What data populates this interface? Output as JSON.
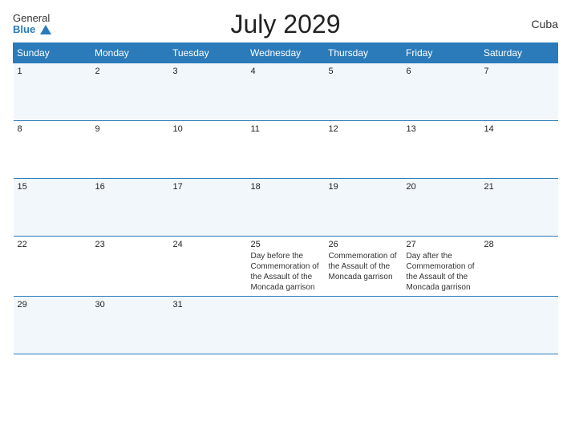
{
  "header": {
    "title": "July 2029",
    "country": "Cuba",
    "logo_general": "General",
    "logo_blue": "Blue"
  },
  "days_of_week": [
    "Sunday",
    "Monday",
    "Tuesday",
    "Wednesday",
    "Thursday",
    "Friday",
    "Saturday"
  ],
  "weeks": [
    [
      {
        "date": "1",
        "events": []
      },
      {
        "date": "2",
        "events": []
      },
      {
        "date": "3",
        "events": []
      },
      {
        "date": "4",
        "events": []
      },
      {
        "date": "5",
        "events": []
      },
      {
        "date": "6",
        "events": []
      },
      {
        "date": "7",
        "events": []
      }
    ],
    [
      {
        "date": "8",
        "events": []
      },
      {
        "date": "9",
        "events": []
      },
      {
        "date": "10",
        "events": []
      },
      {
        "date": "11",
        "events": []
      },
      {
        "date": "12",
        "events": []
      },
      {
        "date": "13",
        "events": []
      },
      {
        "date": "14",
        "events": []
      }
    ],
    [
      {
        "date": "15",
        "events": []
      },
      {
        "date": "16",
        "events": []
      },
      {
        "date": "17",
        "events": []
      },
      {
        "date": "18",
        "events": []
      },
      {
        "date": "19",
        "events": []
      },
      {
        "date": "20",
        "events": []
      },
      {
        "date": "21",
        "events": []
      }
    ],
    [
      {
        "date": "22",
        "events": []
      },
      {
        "date": "23",
        "events": []
      },
      {
        "date": "24",
        "events": []
      },
      {
        "date": "25",
        "events": [
          "Day before the Commemoration of the Assault of the Moncada garrison"
        ]
      },
      {
        "date": "26",
        "events": [
          "Commemoration of the Assault of the Moncada garrison"
        ]
      },
      {
        "date": "27",
        "events": [
          "Day after the Commemoration of the Assault of the Moncada garrison"
        ]
      },
      {
        "date": "28",
        "events": []
      }
    ],
    [
      {
        "date": "29",
        "events": []
      },
      {
        "date": "30",
        "events": []
      },
      {
        "date": "31",
        "events": []
      },
      {
        "date": "",
        "events": []
      },
      {
        "date": "",
        "events": []
      },
      {
        "date": "",
        "events": []
      },
      {
        "date": "",
        "events": []
      }
    ]
  ]
}
